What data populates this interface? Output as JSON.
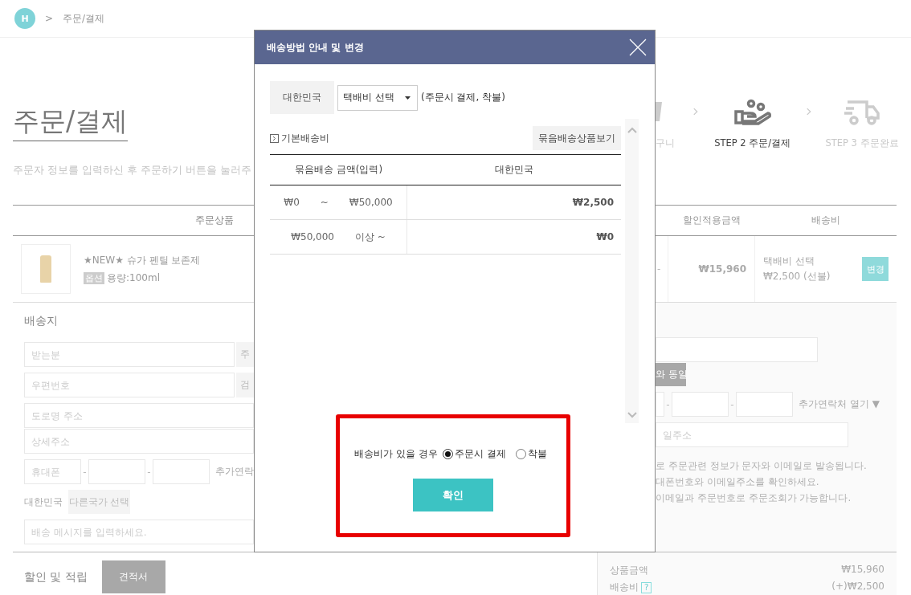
{
  "breadcrumb": {
    "home": "H",
    "separator": ">",
    "current": "주문/결제"
  },
  "page_title": "주문/결제",
  "steps": [
    {
      "label": "구니",
      "selected": false
    },
    {
      "label": "STEP 2  주문/결제",
      "selected": true
    },
    {
      "label": "STEP 3  주문완료",
      "selected": false
    }
  ],
  "intro": "주문자 정보를 입력하신 후 주문하기 버튼을 눌러주",
  "order_table": {
    "columns": [
      "주문상품",
      "할인적용금액",
      "배송비"
    ],
    "rows": [
      {
        "name": "★NEW★ 슈가 펜틸 보존제",
        "option_badge": "옵션",
        "option": "용량:100ml",
        "column_3": "-",
        "price": "₩15,960",
        "shipping_method": "택배비 선택",
        "shipping_fee": "₩2,500 (선불)",
        "button": "변경"
      }
    ]
  },
  "shipping": {
    "title": "배송지",
    "recipient": {
      "placeholder": "받는분",
      "button": "주"
    },
    "zip": {
      "placeholder": "우편번호",
      "button": "검"
    },
    "road_address": {
      "placeholder": "도로명 주소"
    },
    "detail_address": {
      "placeholder": "상세주소"
    },
    "phone": {
      "placeholder": "휴대폰",
      "separators": [
        "-",
        "-"
      ],
      "extra": "추가연락"
    },
    "country": "대한민국",
    "country_button": "다른국가 선택",
    "message": {
      "placeholder": "배송 메시지를 입력하세요."
    }
  },
  "orderer": {
    "same_button": "와 동일",
    "phone_separators": [
      "-",
      "-"
    ],
    "extra_contact": "추가연락처 열기 ▼",
    "email": {
      "placeholder": "일주소"
    },
    "notes": [
      "로 주문관련 정보가 문자와 이메일로 발송됩니다.",
      "대폰번호와 이메일주소를 확인하세요.",
      "이메일과 주문번호로 주문조회가 가능합니다."
    ]
  },
  "discount": {
    "title": "할인 및 적립",
    "button": "견적서"
  },
  "summary": [
    {
      "label": "상품금액",
      "value": "₩15,960"
    },
    {
      "label": "배송비",
      "help": "?",
      "value": "(+)₩2,500"
    }
  ],
  "modal": {
    "title": "배송방법 안내 및 변경",
    "country": "대한민국",
    "select": {
      "value": "택배비 선택"
    },
    "methods_note": "(주문시 결제, 착불)",
    "section_title": "기본배송비",
    "bundle_button": "묶음배송상품보기",
    "fee_table": {
      "columns": [
        "묶음배송 금액(입력)",
        "대한민국"
      ],
      "rows": [
        {
          "range": [
            "₩0",
            "~",
            "₩50,000"
          ],
          "fee": "₩2,500"
        },
        {
          "range": [
            "₩50,000",
            "이상 ~"
          ],
          "fee": "₩0"
        }
      ]
    },
    "prompt": "배송비가 있을 경우",
    "options": [
      {
        "label": "주문시 결제",
        "selected": true
      },
      {
        "label": "착불",
        "selected": false
      }
    ],
    "confirm": "확인"
  }
}
